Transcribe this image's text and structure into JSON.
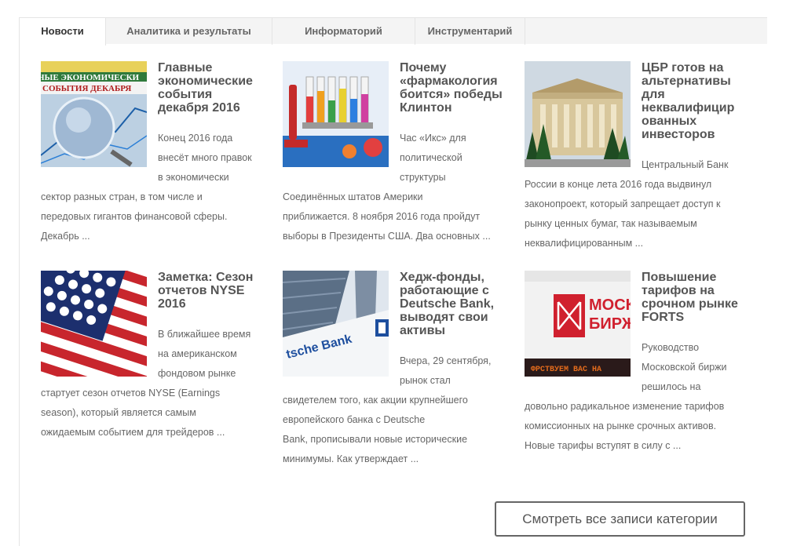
{
  "tabs": [
    {
      "label": "Новости"
    },
    {
      "label": "Аналитика и результаты"
    },
    {
      "label": "Информаторий"
    },
    {
      "label": "Инструментарий"
    }
  ],
  "articles": [
    {
      "title_lines": [
        "Главные",
        "экономические",
        "события",
        "декабря 2016"
      ],
      "excerpt_lines": [
        "Конец 2016 года",
        "внесёт много правок",
        "в экономически",
        "сектор разных стран, в том числе и",
        "передовых гигантов финансовой сферы.",
        "Декабрь ..."
      ],
      "image_text": [
        "НЫЕ ЭКОНОМИЧЕСКИ",
        "СОБЫТИЯ ДЕКАБРЯ"
      ]
    },
    {
      "title_lines": [
        "Почему",
        "«фармакология",
        "боится» победы",
        "Клинтон"
      ],
      "excerpt_lines": [
        "Час «Икс» для",
        "политической",
        "структуры",
        "Соединённых штатов Америки",
        "приближается. 8 ноября 2016 года пройдут",
        "выборы в Президенты США. Два основных ..."
      ]
    },
    {
      "title_lines": [
        "ЦБР готов на",
        "альтернативы",
        "для",
        "неквалифицир",
        "ованных",
        "инвесторов"
      ],
      "excerpt_lines": [
        "Центральный Банк",
        "России в конце лета 2016 года выдвинул",
        "законопроект, который запрещает доступ к",
        "рынку ценных бумаг, так называемым",
        "неквалифицированным ..."
      ]
    },
    {
      "title_lines": [
        "Заметка: Сезон",
        "отчетов NYSE",
        "2016"
      ],
      "excerpt_lines": [
        "В ближайшее время",
        "на американском",
        "фондовом рынке",
        "стартует сезон отчетов NYSE (Earnings",
        "season), который является самым",
        "ожидаемым событием для трейдеров ..."
      ]
    },
    {
      "title_lines": [
        "Хедж-фонды,",
        "работающие с",
        "Deutsche Bank,",
        "выводят свои",
        "активы"
      ],
      "excerpt_lines": [
        "Вчера, 29 сентября,",
        "рынок стал",
        "свидетелем того, как акции крупнейшего",
        "европейского банка с Deutsche",
        "Bank, прописывали новые исторические",
        "минимумы. Как утверждает ..."
      ],
      "image_text": [
        "tsche Bank"
      ]
    },
    {
      "title_lines": [
        "Повышение",
        "тарифов на",
        "срочном рынке",
        "FORTS"
      ],
      "excerpt_lines": [
        "Руководство",
        "Московской биржи",
        "решилось на",
        "довольно радикальное изменение тарифов",
        "комиссионных на рынке срочных активов.",
        "Новые тарифы вступят в силу с ..."
      ],
      "image_text": [
        "МОСК",
        "БИРЖ",
        "ФРСТВУЕМ ВАС НА"
      ]
    }
  ],
  "more_button": {
    "label": "Смотреть все записи категории"
  },
  "colors": {
    "tab_bg": "#f4f4f4",
    "border": "#e4e4e4",
    "title": "#555555",
    "text": "#666666",
    "moex_red": "#d0202e"
  }
}
